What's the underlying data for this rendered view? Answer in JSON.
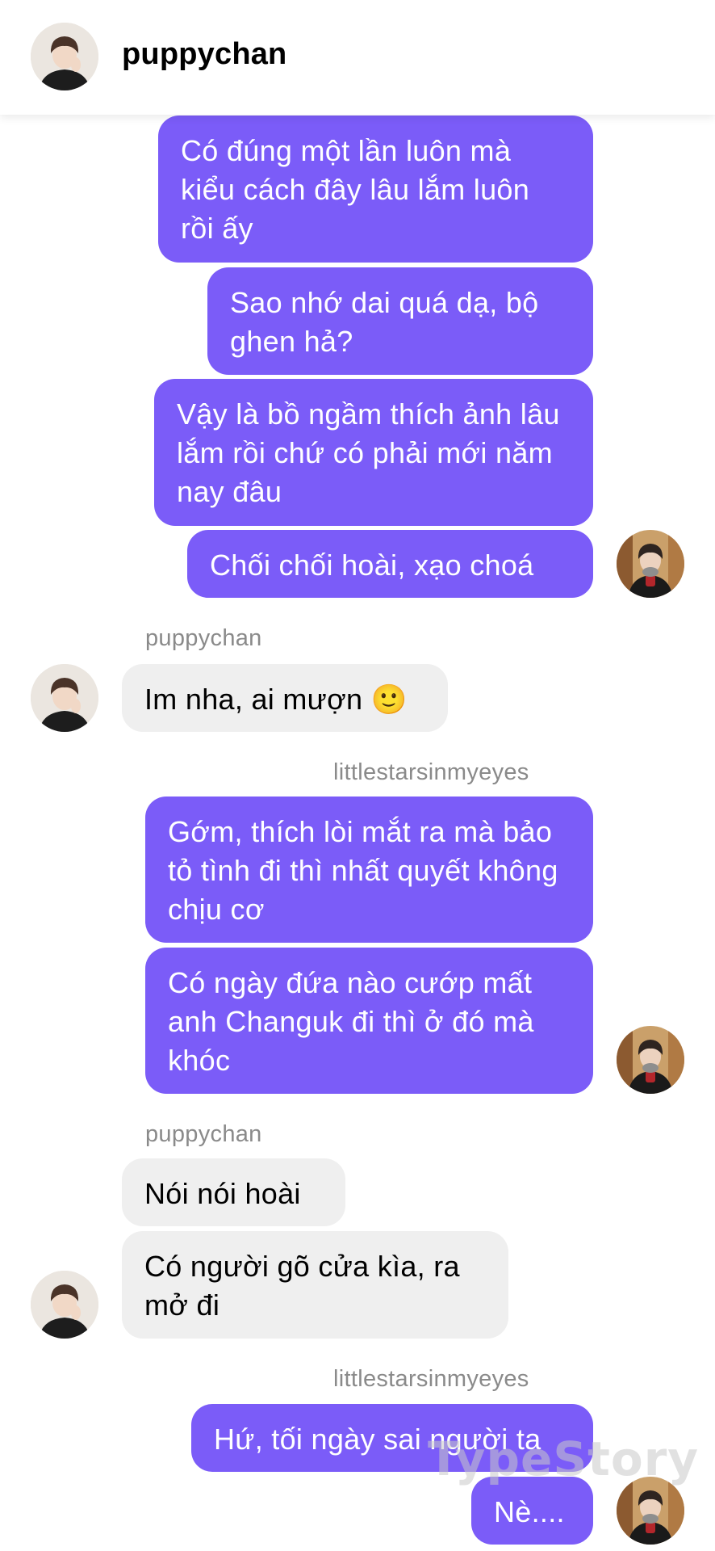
{
  "header": {
    "username": "puppychan"
  },
  "messages": {
    "m1": "Có đúng một lần luôn mà kiểu cách đây lâu lắm luôn rồi ấy",
    "m2": "Sao nhớ dai quá dạ, bộ ghen hả?",
    "m3": "Vậy là bồ ngầm thích ảnh lâu lắm rồi chứ có phải mới năm nay đâu",
    "m4": "Chối chối hoài, xạo choá",
    "name1": "puppychan",
    "m5": "Im nha, ai mượn 🙂",
    "name2": "littlestarsinmyeyes",
    "m6": "Gớm, thích lòi mắt ra mà bảo tỏ tình đi thì nhất quyết không chịu cơ",
    "m7": "Có ngày đứa nào cướp mất anh Changuk đi thì ở đó mà khóc",
    "name3": "puppychan",
    "m8": "Nói nói hoài",
    "m9": "Có người gõ cửa kìa, ra mở đi",
    "name4": "littlestarsinmyeyes",
    "m10": "Hứ, tối ngày sai người ta",
    "m11": "Nè...."
  },
  "watermark": "TypeStory",
  "colors": {
    "sent_bubble": "#7b5cf8",
    "received_bubble": "#efefef",
    "sender_name": "#8a8a8a"
  }
}
